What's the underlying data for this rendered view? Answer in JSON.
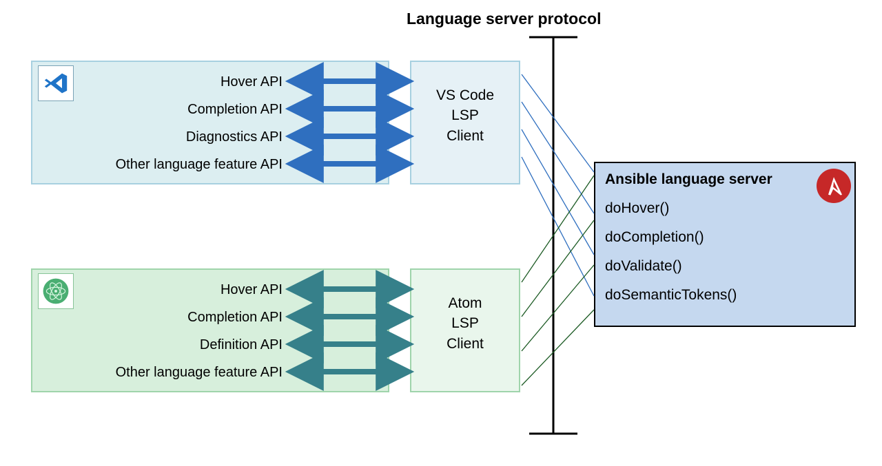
{
  "title": "Language server protocol",
  "vscode": {
    "apis": [
      "Hover API",
      "Completion API",
      "Diagnostics API",
      "Other language feature API"
    ],
    "client_label": "VS Code\nLSP\nClient"
  },
  "atom": {
    "apis": [
      "Hover API",
      "Completion API",
      "Definition API",
      "Other language feature API"
    ],
    "client_label": "Atom\nLSP\nClient"
  },
  "server": {
    "title": "Ansible language server",
    "functions": [
      "doHover()",
      "doCompletion()",
      "doValidate()",
      "doSemanticTokens()"
    ]
  },
  "arrow_colors": {
    "vscode": "#2f6fbf",
    "atom": "#36808a"
  }
}
